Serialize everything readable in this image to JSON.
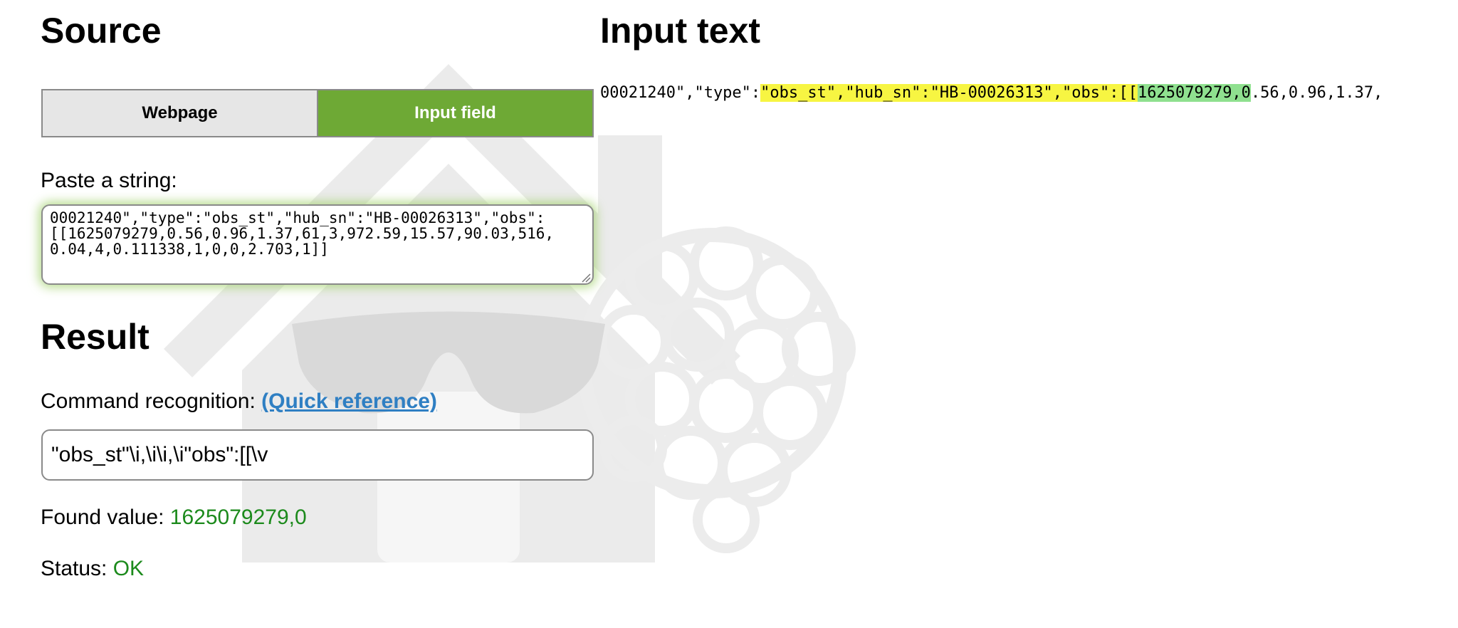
{
  "source": {
    "title": "Source",
    "toggle": {
      "webpage_label": "Webpage",
      "input_field_label": "Input field",
      "selected": "Input field"
    },
    "paste_label": "Paste a string:",
    "paste_value": "00021240\",\"type\":\"obs_st\",\"hub_sn\":\"HB-00026313\",\"obs\":\n[[1625079279,0.56,0.96,1.37,61,3,972.59,15.57,90.03,516,\n0.04,4,0.111338,1,0,0,2.703,1]]"
  },
  "input_text": {
    "title": "Input text",
    "segments": {
      "before": "00021240\",\"type\":",
      "match_yellow": "\"obs_st\",\"hub_sn\":\"HB-00026313\",\"obs\":[[",
      "match_green": "1625079279,0",
      "after": ".56,0.96,1.37,"
    }
  },
  "result": {
    "title": "Result",
    "command_label": "Command recognition: ",
    "quick_reference_label": "(Quick reference)",
    "command_value": "\"obs_st\"\\i,\\i\\i,\\i\"obs\":[[\\v",
    "found_label": "Found value: ",
    "found_value": "1625079279,0",
    "status_label": "Status: ",
    "status_value": "OK"
  },
  "colors": {
    "toggle_active": "#6ea935",
    "toggle_inactive": "#e6e6e6",
    "link": "#2f7fc3",
    "ok_green": "#1c8a1c",
    "highlight_yellow": "#f7f542",
    "highlight_green": "#8fe08f"
  },
  "icons": [
    "house-watermark-icon",
    "sunglasses-watermark-icon",
    "raspberry-watermark-icon",
    "resize-grip-icon"
  ]
}
